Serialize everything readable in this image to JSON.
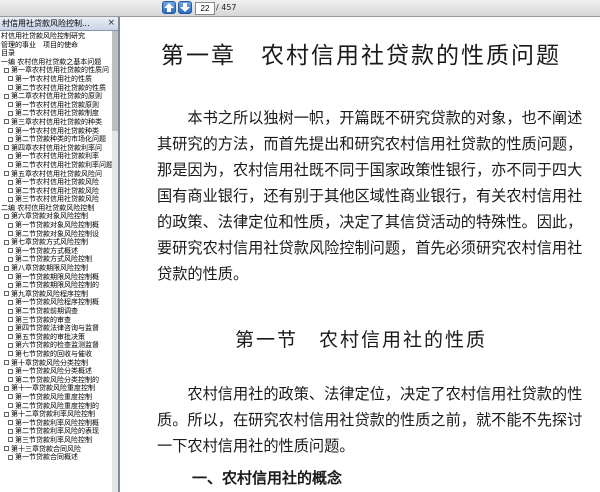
{
  "toolbar": {
    "prev_icon": "arrow-up-icon",
    "next_icon": "arrow-down-icon",
    "current_page": "22",
    "total_pages": "/ 457"
  },
  "sidebar": {
    "tab_title": "村信用社贷款风险控制...",
    "close_symbol": "×",
    "items": [
      {
        "label": "村信用社贷款风险控制研究",
        "indent": 0,
        "box": false
      },
      {
        "label": "管理的事业　项目的使命",
        "indent": 0,
        "box": false
      },
      {
        "label": "目录",
        "indent": 0,
        "box": false
      },
      {
        "label": "一编 农村信用社贷款之基本问题",
        "indent": 0,
        "box": false
      },
      {
        "label": "第一章农村信用社贷款的性质问",
        "indent": 1,
        "box": true
      },
      {
        "label": "第一节农村信用社的性质",
        "indent": 2,
        "box": true
      },
      {
        "label": "第二节农村信用社贷款的性质",
        "indent": 2,
        "box": true
      },
      {
        "label": "第二章农村信用社贷款的原则",
        "indent": 1,
        "box": true
      },
      {
        "label": "第一节农村信用社贷款原则",
        "indent": 2,
        "box": true
      },
      {
        "label": "第二节农村信用社贷款制度",
        "indent": 2,
        "box": true
      },
      {
        "label": "第三章农村信用社贷款的种类",
        "indent": 1,
        "box": true
      },
      {
        "label": "第一节农村信用社贷款种类",
        "indent": 2,
        "box": true
      },
      {
        "label": "第二节贷款种类的市场化问题",
        "indent": 2,
        "box": true
      },
      {
        "label": "第四章农村信用社贷款利率问",
        "indent": 1,
        "box": true
      },
      {
        "label": "第一节农村信用社贷款利率",
        "indent": 2,
        "box": true
      },
      {
        "label": "第二节农村信用社贷款利率问题",
        "indent": 2,
        "box": true
      },
      {
        "label": "第五章农村信用社贷款风险问",
        "indent": 1,
        "box": true
      },
      {
        "label": "第一节农村信用社贷款风险",
        "indent": 2,
        "box": true
      },
      {
        "label": "第二节农村信用社贷款风险",
        "indent": 2,
        "box": true
      },
      {
        "label": "第三节农村信用社贷款风险",
        "indent": 2,
        "box": true
      },
      {
        "label": "二编 农村信用社贷款风险控制",
        "indent": 0,
        "box": false
      },
      {
        "label": "第六章贷款对象风险控制",
        "indent": 1,
        "box": true
      },
      {
        "label": "第一节贷款对象风险控制概",
        "indent": 2,
        "box": true
      },
      {
        "label": "第二节贷款对象风险控制设",
        "indent": 2,
        "box": true
      },
      {
        "label": "第七章贷款方式风险控制",
        "indent": 1,
        "box": true
      },
      {
        "label": "第一节贷款方式概述",
        "indent": 2,
        "box": true
      },
      {
        "label": "第二节贷款方式风险控制",
        "indent": 2,
        "box": true
      },
      {
        "label": "第八章贷款期限风险控制",
        "indent": 1,
        "box": true
      },
      {
        "label": "第一节贷款期限风险控制概",
        "indent": 2,
        "box": true
      },
      {
        "label": "第二节贷款期限风险控制的",
        "indent": 2,
        "box": true
      },
      {
        "label": "第九章贷款风险程序控制",
        "indent": 1,
        "box": true
      },
      {
        "label": "第一节贷款风险程序控制概",
        "indent": 2,
        "box": true
      },
      {
        "label": "第二节贷款前期调查",
        "indent": 2,
        "box": true
      },
      {
        "label": "第三节贷款的审查",
        "indent": 2,
        "box": true
      },
      {
        "label": "第四节贷款法律咨询与监督",
        "indent": 2,
        "box": true
      },
      {
        "label": "第五节贷款的审批决策",
        "indent": 2,
        "box": true
      },
      {
        "label": "第六节贷款的检查监测监督",
        "indent": 2,
        "box": true
      },
      {
        "label": "第七节贷款的回收与催收",
        "indent": 2,
        "box": true
      },
      {
        "label": "第十章贷款风险分类控制",
        "indent": 1,
        "box": true
      },
      {
        "label": "第一节贷款风险分类概述",
        "indent": 2,
        "box": true
      },
      {
        "label": "第二节贷款风险分类控制的",
        "indent": 2,
        "box": true
      },
      {
        "label": "第十一章贷款风险重度控制",
        "indent": 1,
        "box": true
      },
      {
        "label": "第一节贷款风险重度控制",
        "indent": 2,
        "box": true
      },
      {
        "label": "第二节贷款风险重度控制的",
        "indent": 2,
        "box": true
      },
      {
        "label": "第十二章贷款利率风险控制",
        "indent": 1,
        "box": true
      },
      {
        "label": "第一节贷款利率风险控制概",
        "indent": 2,
        "box": true
      },
      {
        "label": "第二节贷款利率风险的表现",
        "indent": 2,
        "box": true
      },
      {
        "label": "第三节贷款利率风险控制",
        "indent": 2,
        "box": true
      },
      {
        "label": "第十三章贷款合同风险",
        "indent": 1,
        "box": true
      },
      {
        "label": "第一节贷款合同概述",
        "indent": 2,
        "box": true
      }
    ]
  },
  "document": {
    "chapter_title": "第一章　农村信用社贷款的性质问题",
    "paragraph1": "本书之所以独树一帜，开篇既不研究贷款的对象，也不阐述其研究的方法，而首先提出和研究农村信用社贷款的性质问题，那是因为，农村信用社既不同于国家政策性银行，亦不同于四大国有商业银行，还有别于其他区域性商业银行，有关农村信用社的政策、法律定位和性质，决定了其信贷活动的特殊性。因此，要研究农村信用社贷款风险控制问题，首先必须研究农村信用社贷款的性质。",
    "section_title": "第一节　农村信用社的性质",
    "paragraph2": "农村信用社的政策、法律定位，决定了农村信用社贷款的性质。所以，在研究农村信用社贷款的性质之前，就不能不先探讨一下农村信用社的性质问题。",
    "subheading": "一、农村信用社的概念"
  }
}
